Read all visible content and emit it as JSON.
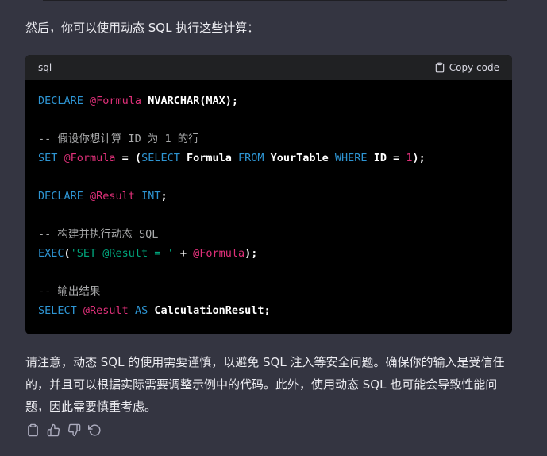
{
  "message": {
    "intro": "然后，你可以使用动态 SQL 执行这些计算：",
    "note": "请注意，动态 SQL 的使用需要谨慎，以避免 SQL 注入等安全问题。确保你的输入是受信任的，并且可以根据实际需要调整示例中的代码。此外，使用动态 SQL 也可能会导致性能问题，因此需要慎重考虑。"
  },
  "code": {
    "language": "sql",
    "copy_label": "Copy code",
    "lines": [
      [
        {
          "t": "kw",
          "v": "DECLARE "
        },
        {
          "t": "var",
          "v": "@Formula"
        },
        {
          "t": "tx",
          "v": " NVARCHAR(MAX);"
        }
      ],
      [],
      [
        {
          "t": "cm",
          "v": "-- 假设你想计算 ID 为 1 的行"
        }
      ],
      [
        {
          "t": "kw",
          "v": "SET "
        },
        {
          "t": "var",
          "v": "@Formula"
        },
        {
          "t": "tx",
          "v": " = ("
        },
        {
          "t": "kw",
          "v": "SELECT"
        },
        {
          "t": "tx",
          "v": " Formula "
        },
        {
          "t": "kw",
          "v": "FROM"
        },
        {
          "t": "tx",
          "v": " YourTable "
        },
        {
          "t": "kw",
          "v": "WHERE"
        },
        {
          "t": "tx",
          "v": " ID = "
        },
        {
          "t": "num",
          "v": "1"
        },
        {
          "t": "tx",
          "v": ");"
        }
      ],
      [],
      [
        {
          "t": "kw",
          "v": "DECLARE "
        },
        {
          "t": "var",
          "v": "@Result"
        },
        {
          "t": "kw",
          "v": " INT"
        },
        {
          "t": "tx",
          "v": ";"
        }
      ],
      [],
      [
        {
          "t": "cm",
          "v": "-- 构建并执行动态 SQL"
        }
      ],
      [
        {
          "t": "kw",
          "v": "EXEC"
        },
        {
          "t": "tx",
          "v": "("
        },
        {
          "t": "str",
          "v": "'SET @Result = '"
        },
        {
          "t": "tx",
          "v": " + "
        },
        {
          "t": "var",
          "v": "@Formula"
        },
        {
          "t": "tx",
          "v": ");"
        }
      ],
      [],
      [
        {
          "t": "cm",
          "v": "-- 输出结果"
        }
      ],
      [
        {
          "t": "kw",
          "v": "SELECT "
        },
        {
          "t": "var",
          "v": "@Result"
        },
        {
          "t": "kw",
          "v": " AS "
        },
        {
          "t": "tx",
          "v": "CalculationResult;"
        }
      ]
    ]
  },
  "actions": {
    "icons": [
      "clipboard-icon",
      "thumbs-up-icon",
      "thumbs-down-icon",
      "regenerate-icon"
    ]
  },
  "colors": {
    "background": "#343541",
    "code_background": "#000000",
    "code_header": "#202123",
    "keyword": "#2e95d3",
    "variable": "#df3079",
    "string": "#00a67d",
    "comment": "#a9aaab"
  }
}
